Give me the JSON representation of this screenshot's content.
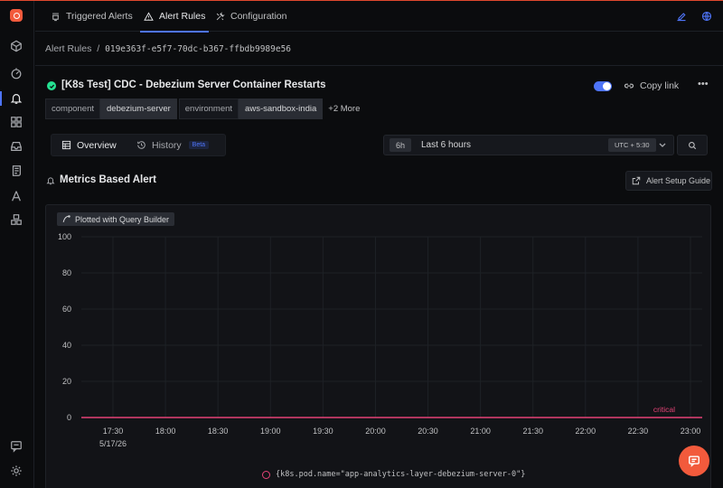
{
  "topbar": {
    "tabs": [
      {
        "label": "Triggered Alerts",
        "icon": "bell-list-icon"
      },
      {
        "label": "Alert Rules",
        "icon": "alert-triangle-icon"
      },
      {
        "label": "Configuration",
        "icon": "tools-icon"
      }
    ],
    "active_tab": "Alert Rules"
  },
  "breadcrumb": {
    "root": "Alert Rules",
    "separator": "/",
    "id": "019e363f-e5f7-70dc-b367-ffbdb9989e56"
  },
  "alert": {
    "status": "ok",
    "title": "[K8s Test] CDC - Debezium Server Container Restarts",
    "enabled": true,
    "copy_link_label": "Copy link",
    "more_label": "•••",
    "tags": [
      {
        "key": "component",
        "value": "debezium-server"
      },
      {
        "key": "environment",
        "value": "aws-sandbox-india"
      }
    ],
    "more_tags_label": "+2 More"
  },
  "view_tabs": {
    "overview": "Overview",
    "history": "History",
    "history_badge": "Beta"
  },
  "time_picker": {
    "short": "6h",
    "label": "Last 6 hours",
    "timezone": "UTC + 5:30"
  },
  "section": {
    "title": "Metrics Based Alert",
    "guide_label": "Alert Setup Guide"
  },
  "chart_panel": {
    "plotted_with": "Plotted with Query Builder"
  },
  "chart_data": {
    "type": "line",
    "ylim": [
      0,
      100
    ],
    "yticks": [
      0,
      20,
      40,
      60,
      80,
      100
    ],
    "x_tick_labels": [
      "17:30",
      "18:00",
      "18:30",
      "19:00",
      "19:30",
      "20:00",
      "20:30",
      "21:00",
      "21:30",
      "22:00",
      "22:30",
      "23:00"
    ],
    "x_date_label": "5/17/26",
    "series": [
      {
        "name": "{k8s.pod.name=\"app-analytics-layer-debezium-server-0\"}",
        "values": [
          0,
          0,
          0,
          0,
          0,
          0,
          0,
          0,
          0,
          0,
          0,
          0,
          0
        ],
        "color": "#e54377"
      }
    ],
    "threshold": {
      "label": "critical",
      "value": 0,
      "color": "#e54377"
    },
    "grid": true,
    "legend_position": "bottom"
  },
  "colors": {
    "accent": "#4e74f8",
    "brand": "#f25a3c",
    "ok": "#25e192",
    "critical": "#e54377"
  }
}
